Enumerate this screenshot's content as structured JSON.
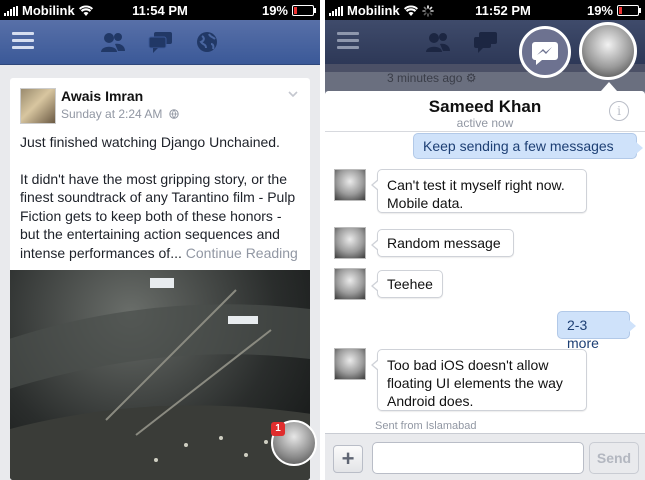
{
  "left_phone": {
    "status": {
      "carrier": "Mobilink",
      "time": "11:54 PM",
      "battery": "19%"
    },
    "post": {
      "author": "Awais Imran",
      "meta": "Sunday at 2:24 AM",
      "paragraphs": [
        "Just finished watching Django Unchained.",
        "It didn't have the most gripping story, or the finest soundtrack of any Tarantino film - Pulp Fiction gets to keep both of these honors - but the entertaining action sequences and intense performances of..."
      ],
      "continue_link": "Continue Reading"
    },
    "chat_head_badge": "1"
  },
  "right_phone": {
    "status": {
      "carrier": "Mobilink",
      "time": "11:52 PM",
      "battery": "19%"
    },
    "feed_timestamp": "3 minutes ago",
    "chat": {
      "contact_name": "Sameed Khan",
      "contact_status": "active now",
      "messages": [
        {
          "from": "me",
          "text": "Keep sending a few messages"
        },
        {
          "from": "them",
          "text": "Can't test it myself right now. Mobile data."
        },
        {
          "from": "them",
          "text": "Random message"
        },
        {
          "from": "them",
          "text": "Teehee"
        },
        {
          "from": "me",
          "text": "2-3 more"
        },
        {
          "from": "them",
          "text": "Too bad iOS doesn't allow floating UI elements the way Android does."
        }
      ],
      "sent_from": "Sent from Islamabad",
      "composer": {
        "add_label": "+",
        "input_value": "",
        "input_placeholder": "",
        "send_label": "Send"
      }
    }
  },
  "colors": {
    "facebook_blue": "#3b5998",
    "outgoing_bubble": "#cfe2fa",
    "badge_red": "#e02d2d"
  },
  "icons": [
    "menu-icon",
    "friend-requests-icon",
    "messages-icon",
    "notifications-globe-icon",
    "messenger-icon",
    "info-icon",
    "privacy-globe-icon",
    "chevron-down-icon",
    "wifi-icon",
    "battery-icon"
  ]
}
